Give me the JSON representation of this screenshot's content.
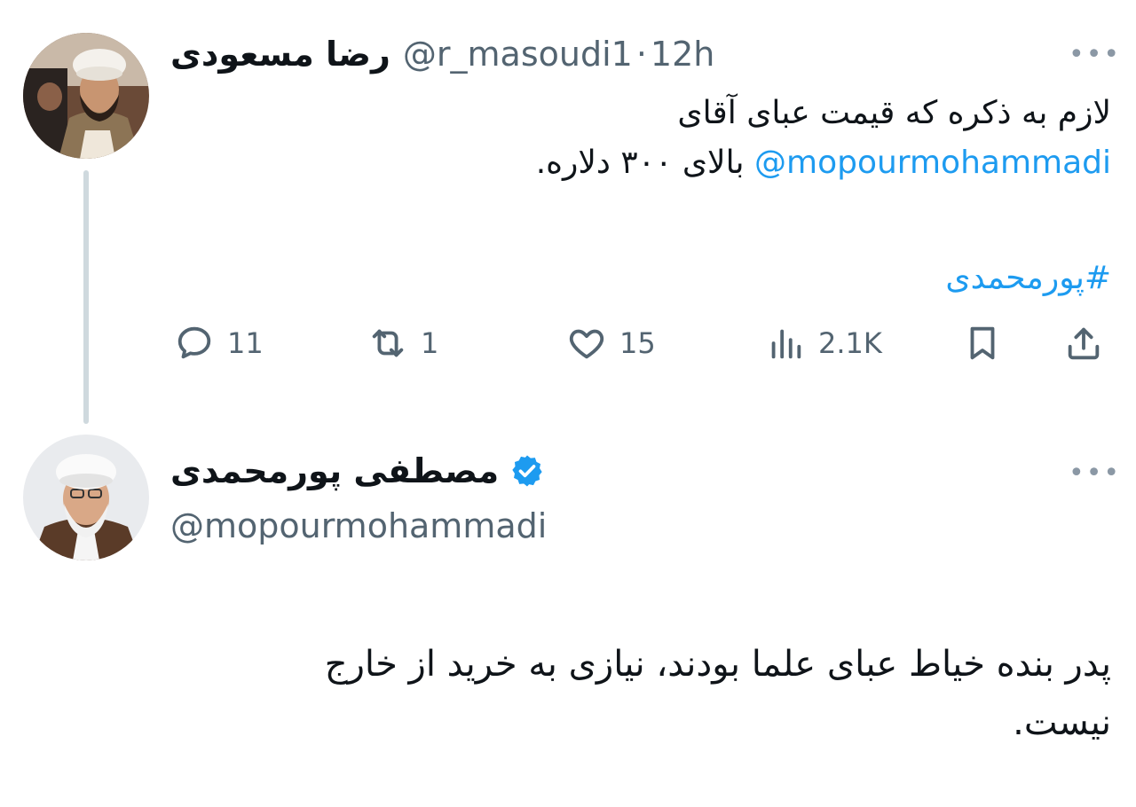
{
  "tweet": {
    "author_name": "رضا مسعودی",
    "handle": "@r_masoudi1",
    "separator": "·",
    "time": "12h",
    "more_label": "•••",
    "line1": "لازم به ذکره که قیمت عبای آقای",
    "mention": "@mopourmohammadi",
    "line2_rest": " بالای ۳۰۰ دلاره.",
    "hashtag": "#پورمحمدی",
    "actions": {
      "replies": "11",
      "reposts": "1",
      "likes": "15",
      "views": "2.1K"
    },
    "icons": [
      "reply-icon",
      "repost-icon",
      "like-icon",
      "views-icon",
      "bookmark-icon",
      "share-icon"
    ]
  },
  "reply": {
    "author_name": "مصطفی پورمحمدی",
    "verified_icon": "verified-badge-icon",
    "handle": "@mopourmohammadi",
    "more_label": "•••",
    "line1": "پدر بنده خیاط عبای علما بودند، نیازی به خرید از خارج",
    "line2": "نیست."
  },
  "colors": {
    "link": "#1d9bf0",
    "secondary": "#536471",
    "thread_line": "#cfd9de"
  }
}
